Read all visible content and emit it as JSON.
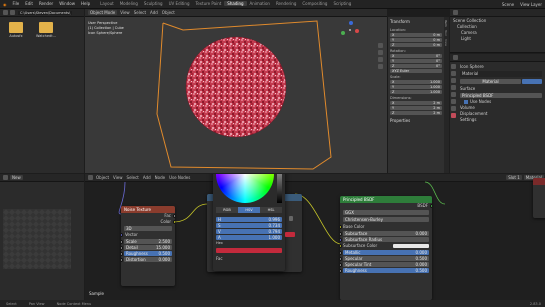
{
  "menu": {
    "items": [
      "File",
      "Edit",
      "Render",
      "Window",
      "Help"
    ],
    "workspaces": [
      "Layout",
      "Modeling",
      "Sculpting",
      "UV Editing",
      "Texture Paint",
      "Shading",
      "Animation",
      "Rendering",
      "Compositing",
      "Scripting"
    ],
    "active_workspace": "Shading",
    "scene": "Scene",
    "view_layer": "View Layer"
  },
  "file_browser": {
    "path": "C:\\Users\\Steven\\Documents\\",
    "folders": [
      "Autosfx",
      "Watchedt..."
    ]
  },
  "viewport": {
    "mode": "Object Mode",
    "menus": [
      "View",
      "Select",
      "Add",
      "Object"
    ],
    "overlay_lines": [
      "User Perspective",
      "(1) Collection | Cube",
      "Icon Sphere/Sphere"
    ],
    "colors": {
      "sphere": "#b93a4a",
      "wire": "#e08a2c"
    }
  },
  "n_panel": {
    "tabs": [
      "Item",
      "Tool",
      "View"
    ],
    "section_transform": "Transform",
    "location_label": "Location:",
    "rotation_label": "Rotation:",
    "scale_label": "Scale:",
    "dimensions_label": "Dimensions:",
    "loc": [
      {
        "axis": "X",
        "val": "0 m"
      },
      {
        "axis": "Y",
        "val": "0 m"
      },
      {
        "axis": "Z",
        "val": "0 m"
      }
    ],
    "rot": [
      {
        "axis": "X",
        "val": "0°"
      },
      {
        "axis": "Y",
        "val": "0°"
      },
      {
        "axis": "Z",
        "val": "0°"
      }
    ],
    "rot_mode": "XYZ Euler",
    "scale": [
      {
        "axis": "X",
        "val": "1.000"
      },
      {
        "axis": "Y",
        "val": "1.000"
      },
      {
        "axis": "Z",
        "val": "1.000"
      }
    ],
    "dims": [
      {
        "axis": "X",
        "val": "2 m"
      },
      {
        "axis": "Y",
        "val": "2 m"
      },
      {
        "axis": "Z",
        "val": "2 m"
      }
    ],
    "properties_label": "Properties"
  },
  "outliner": {
    "root": "Scene Collection",
    "items": [
      "Collection",
      "Camera",
      "Light"
    ]
  },
  "properties": {
    "object_name": "Icon Sphere",
    "material": "Material",
    "surface_label": "Surface",
    "rows": [
      "Preview",
      "Surface",
      "Use Nodes"
    ],
    "surface_value": "Principled BSDF",
    "volume_label": "Volume",
    "displacement_label": "Displacement",
    "settings_label": "Settings"
  },
  "node_editor": {
    "header_items": [
      "Object",
      "View",
      "Select",
      "Add",
      "Node",
      "Use Nodes"
    ],
    "slot": "Slot 1",
    "mat_name": "Material",
    "footer_label": "Sample"
  },
  "image_editor": {
    "label": "New"
  },
  "noise_node": {
    "title": "Noise Texture",
    "out_fac": "Fac",
    "out_color": "Color",
    "dim": "3D",
    "in_vector": "Vector",
    "fields": [
      {
        "label": "Scale",
        "value": "2.500"
      },
      {
        "label": "Detail",
        "value": "15.000"
      },
      {
        "label": "Roughness",
        "value": "0.500"
      },
      {
        "label": "Distortion",
        "value": "0.000"
      }
    ],
    "color": "#8a3c2d"
  },
  "color_popup": {
    "modes": [
      "RGB",
      "HSV",
      "HSL"
    ],
    "active_mode": "HSV",
    "hsv": [
      {
        "label": "H",
        "value": "0.996"
      },
      {
        "label": "S",
        "value": "0.734"
      },
      {
        "label": "V",
        "value": "0.794"
      },
      {
        "label": "A",
        "value": "1.000"
      }
    ],
    "hex_label": "Hex",
    "swatch": "#c32a3c",
    "mix_label": "Fac"
  },
  "bsdf_node": {
    "title": "Principled BSDF",
    "out_bsdf": "BSDF",
    "distribution": "GGX",
    "subsurface_method": "Christensen-Burley",
    "rows": [
      {
        "label": "Base Color",
        "type": "socket"
      },
      {
        "label": "Subsurface",
        "value": "0.000"
      },
      {
        "label": "Subsurface Radius",
        "type": "dropdown"
      },
      {
        "label": "Subsurface Color",
        "type": "swatch"
      },
      {
        "label": "Metallic",
        "value": "0.000"
      },
      {
        "label": "Specular",
        "value": "0.500"
      },
      {
        "label": "Specular Tint",
        "value": "0.000"
      },
      {
        "label": "Roughness",
        "value": "0.500"
      }
    ],
    "color": "#2e7d3a"
  },
  "statusbar": {
    "left": "Select",
    "mid": "Pan View",
    "right": "Node Context Menu",
    "version": "2.83.0"
  }
}
